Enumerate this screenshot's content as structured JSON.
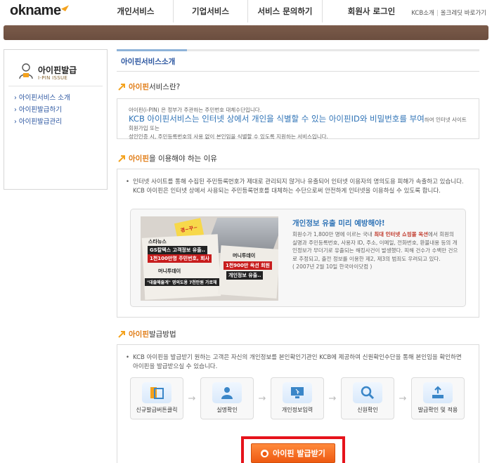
{
  "header": {
    "logo": "okname",
    "nav": [
      "개인서비스",
      "기업서비스",
      "서비스 문의하기",
      "회원사 로그인"
    ],
    "util": [
      "KCB소개",
      "올크레딧 바로가기"
    ]
  },
  "sidebar": {
    "title": "아이핀발급",
    "subtitle": "I-PIN ISSUE",
    "items": [
      "아이핀서비스 소개",
      "아이핀발급하기",
      "아이핀발급관리"
    ]
  },
  "main": {
    "tab": "아이핀서비스소개",
    "section1": {
      "title_a": "아이핀",
      "title_b": " 서비스란?",
      "line1": "아이핀(i-PIN) 은 정부가 주관하는 주민번호 대체수단입니다.",
      "big": "KCB 아이핀서비스는 인터넷 상에서 개인을 식별할 수 있는 아이핀ID와 비밀번호를 부여",
      "tail": "하여 인터넷 사이트 회원가입 또는",
      "line3": "성인인증 시, 주민등록번호의 사용 없이 본인임을 식별할 수 있도록 지원하는 서비스입니다."
    },
    "section2": {
      "title_a": "아이핀",
      "title_b": "을 이용해야 하는 이유",
      "text": "인터넷 사이트를 통해 수집된 주민등록번호가 제대로 관리되지 않거나 유출되어 인터넷 이용자의 명의도용 피해가 속출하고 있습니다. KCB 아이핀은 인터넷 상에서 사용되는 주민등록번호를 대체하는 수단으로써 안전하게 인터넷을 이용하실 수 있도록 합니다.",
      "news": {
        "stamp": "경~꾸~",
        "h1": "스타뉴스",
        "h2": "GS칼텍스 고객정보 유출..",
        "h3": "1천100만명 주민번호, 회사",
        "h4": "머니투데이",
        "h5": "\"대출해줄게\" 명의도용 7천만원 가로채",
        "h6": "머니투데이",
        "h7": "1천900만 옥션 회원",
        "h8": "개인정보 유출.."
      },
      "inner_title": "개인정보 유출 미리 예방해야!",
      "inner_text_a": "회원수가 1,800만 명에 이르는 국내 ",
      "inner_em": "최대 인터넷 쇼핑몰 옥션",
      "inner_text_b": "에서 회원의 실명과 주민등록번호, 사용자 ID, 주소, 이메일, 전화번호, 환불내용 등의 개인정보가 무더기로 유출되는 해킹사건이 발생했다. 피해 건수가 수백만 건으로 추정되고, 출전 정보를 이용한 제2, 제3의 범죄도 우려되고 있다.",
      "inner_src": "( 2007년 2월 10일 한국아이닷컴 )"
    },
    "section3": {
      "title_a": "아이핀",
      "title_b": " 발급방법",
      "text": "KCB 아이핀을 발급받기 원하는 고객은 자신의 개인정보를 본인확인기관인 KCB에 제공하여 신원확인수단을 통해 본인임을 확인하면 아이핀을 발급받으실 수 있습니다.",
      "steps": [
        "신규발급버튼클릭",
        "실명확인",
        "개인정보입력",
        "신원확인",
        "발급확인 및 적용"
      ],
      "button": "아이핀 발급받기"
    }
  }
}
